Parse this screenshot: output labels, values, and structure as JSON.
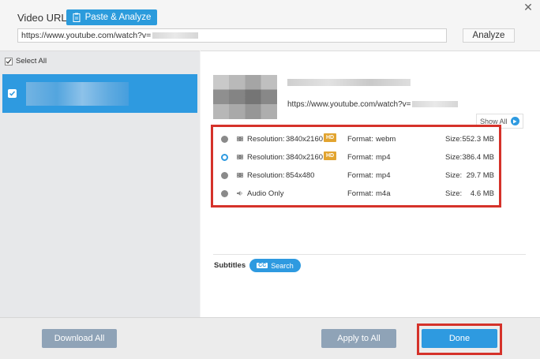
{
  "header": {
    "url_label": "Video URL:",
    "paste_label": "Paste & Analyze",
    "url_value": "https://www.youtube.com/watch?v=",
    "analyze_label": "Analyze",
    "close_glyph": "✕"
  },
  "left": {
    "select_all_label": "Select All",
    "select_all_checked": true,
    "item_checked": true
  },
  "video": {
    "url": "https://www.youtube.com/watch?v=",
    "show_all_label": "Show All"
  },
  "formats": [
    {
      "type": "video",
      "res_label": "Resolution:",
      "resolution": "3840x2160",
      "hd": "HD",
      "format_label": "Format:",
      "format": "webm",
      "size_label": "Size:",
      "size": "552.3 MB",
      "selected": false
    },
    {
      "type": "video",
      "res_label": "Resolution:",
      "resolution": "3840x2160",
      "hd": "HD",
      "format_label": "Format:",
      "format": "mp4",
      "size_label": "Size:",
      "size": "386.4 MB",
      "selected": true
    },
    {
      "type": "video",
      "res_label": "Resolution:",
      "resolution": "854x480",
      "hd": "",
      "format_label": "Format:",
      "format": "mp4",
      "size_label": "Size:",
      "size": "29.7 MB",
      "selected": false
    },
    {
      "type": "audio",
      "res_label": "Audio Only",
      "resolution": "",
      "hd": "",
      "format_label": "Format:",
      "format": "m4a",
      "size_label": "Size:",
      "size": "4.6 MB",
      "selected": false
    }
  ],
  "subtitles": {
    "label": "Subtitles",
    "search_label": "Search",
    "cc_glyph": "CC"
  },
  "footer": {
    "download_all_label": "Download All",
    "apply_all_label": "Apply to All",
    "done_label": "Done"
  },
  "colors": {
    "accent": "#2e9ae0",
    "highlight": "#d5322a",
    "hd_badge": "#e2a430",
    "disabled_button": "#8fa3b7"
  }
}
